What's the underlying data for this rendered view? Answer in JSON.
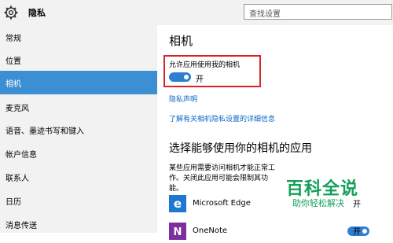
{
  "header": {
    "app_title": "隐私",
    "search_placeholder": "查找设置"
  },
  "sidebar": {
    "items": [
      {
        "label": "常规"
      },
      {
        "label": "位置"
      },
      {
        "label": "相机",
        "active": true
      },
      {
        "label": "麦克风"
      },
      {
        "label": "语音、墨迹书写和键入"
      },
      {
        "label": "帐户信息"
      },
      {
        "label": "联系人"
      },
      {
        "label": "日历"
      },
      {
        "label": "消息传送"
      }
    ]
  },
  "main": {
    "title": "相机",
    "permission_label": "允许应用使用我的相机",
    "permission_state": "开",
    "privacy_link": "隐私声明",
    "learn_more_link": "了解有关相机隐私设置的详细信息",
    "section_title": "选择能够使用你的相机的应用",
    "section_desc": "某些应用需要访问相机才能正常工作。关闭此应用可能会限制其功能。",
    "apps": [
      {
        "name": "Microsoft Edge",
        "state": "开"
      },
      {
        "name": "OneNote",
        "state": "开"
      }
    ]
  },
  "watermark": {
    "text": "百科全说",
    "sub": "助你轻松解决"
  },
  "colors": {
    "accent": "#2e7fd4",
    "sidebar_active": "#3d8fd3",
    "highlight": "#d6242a",
    "link": "#0b67c6",
    "watermark": "#14a05a"
  }
}
